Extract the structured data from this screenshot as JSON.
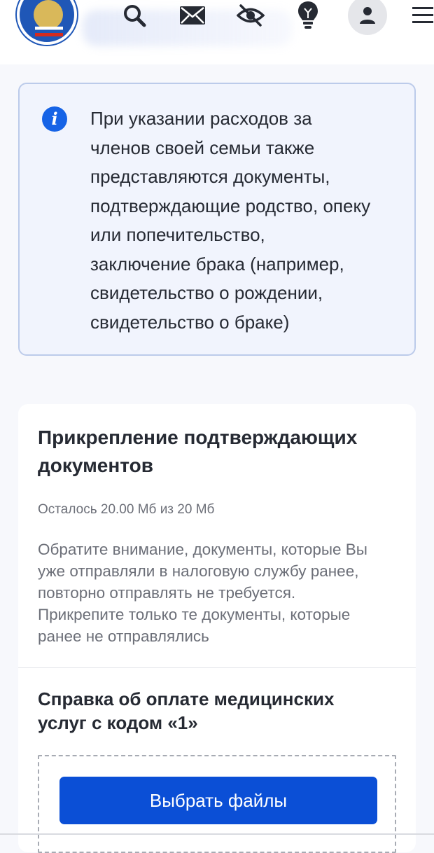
{
  "info": {
    "text": "При указании расходов за\nчленов своей семьи также\nпредставляются документы,\nподтверждающие родство, опеку\nили попечительство,\nзаключение брака (например,\nсвидетельство о рождении,\nсвидетельство о браке)"
  },
  "attachments": {
    "title": "Прикрепление подтверждающих\nдокументов",
    "remaining": "Осталось 20.00 Мб из 20 Мб",
    "notice": "Обратите внимание, документы, которые Вы\nуже отправляли в налоговую службу ранее,\nповторно отправлять не требуется.\nПрикрепите только те документы, которые\nранее не отправлялись",
    "section_title": "Справка об оплате медицинских\nуслуг с кодом «1»",
    "choose_files_label": "Выбрать файлы"
  },
  "icons": {
    "logo": "fns-emblem-logo",
    "search": "search-icon",
    "mail": "envelope-icon",
    "accessibility": "eye-slash-icon",
    "tips": "lightbulb-icon",
    "profile": "user-icon",
    "menu": "hamburger-icon",
    "info": "info-icon"
  },
  "colors": {
    "primary_button": "#0b4fd6",
    "info_icon": "#1663e6",
    "info_bg": "#f1f4fd",
    "info_border": "#bccbea"
  }
}
